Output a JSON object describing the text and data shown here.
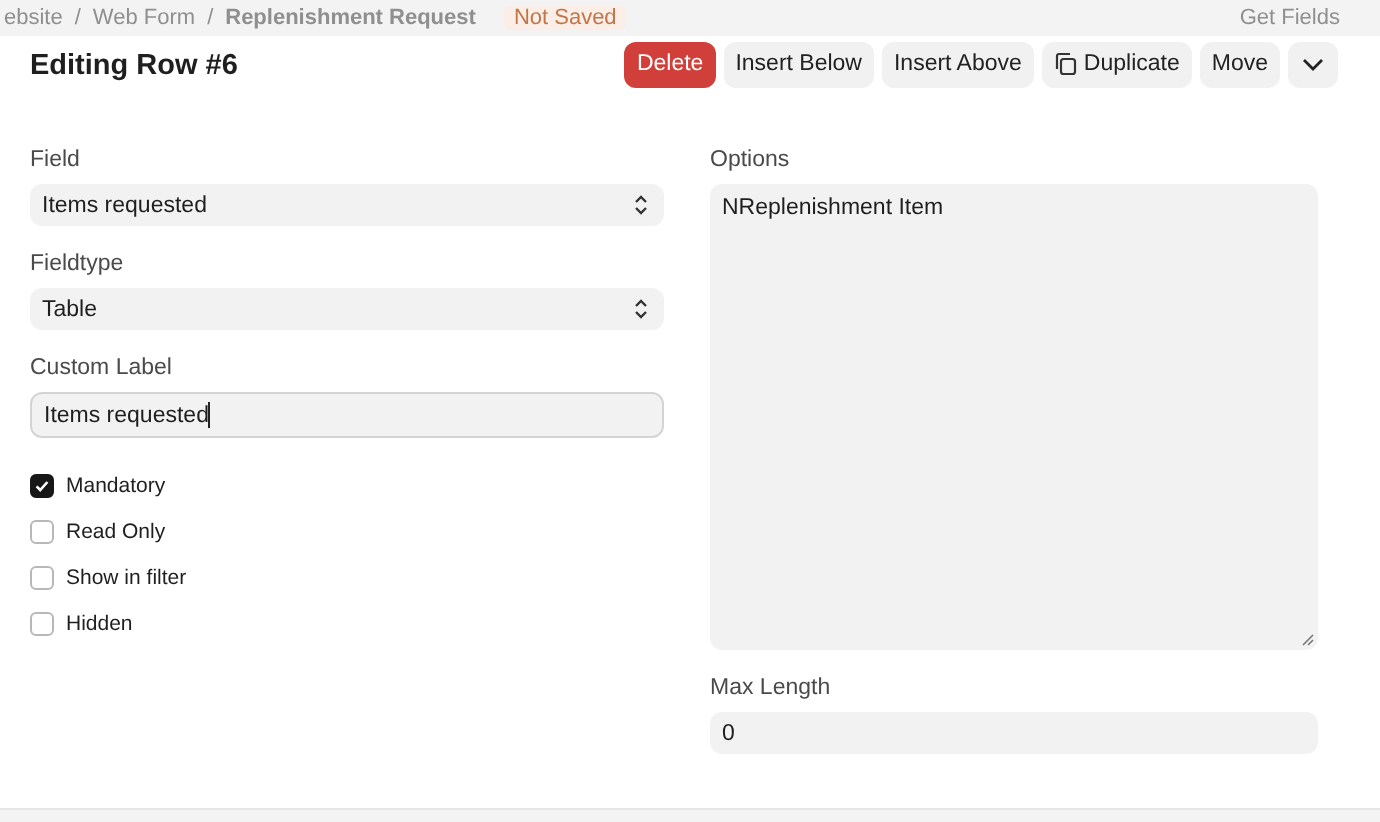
{
  "backdrop": {
    "breadcrumbs": [
      "ebsite",
      "Web Form",
      "Replenishment Request"
    ],
    "separator": "/",
    "status": "Not Saved",
    "action": "Get Fields"
  },
  "title": "Editing Row #6",
  "buttons": [
    {
      "label": "Delete",
      "kind": "danger"
    },
    {
      "label": "Insert Below",
      "kind": "plain"
    },
    {
      "label": "Insert Above",
      "kind": "plain"
    },
    {
      "label": "Duplicate",
      "kind": "copy"
    },
    {
      "label": "Move",
      "kind": "plain"
    },
    {
      "kind": "caret"
    }
  ],
  "left": [
    {
      "label": "Field",
      "kind": "select",
      "value": "Items requested"
    },
    {
      "label": "Fieldtype",
      "kind": "select",
      "value": "Table"
    },
    {
      "label": "Custom Label",
      "kind": "input",
      "value": "Items requested",
      "focused": true
    }
  ],
  "checks": [
    {
      "label": "Mandatory",
      "checked": true
    },
    {
      "label": "Read Only",
      "checked": false
    },
    {
      "label": "Show in filter",
      "checked": false
    },
    {
      "label": "Hidden",
      "checked": false
    }
  ],
  "right": [
    {
      "label": "Options",
      "kind": "textarea",
      "value": "NReplenishment Item"
    },
    {
      "label": "Max Length",
      "kind": "input",
      "value": "0",
      "focused": false
    }
  ]
}
